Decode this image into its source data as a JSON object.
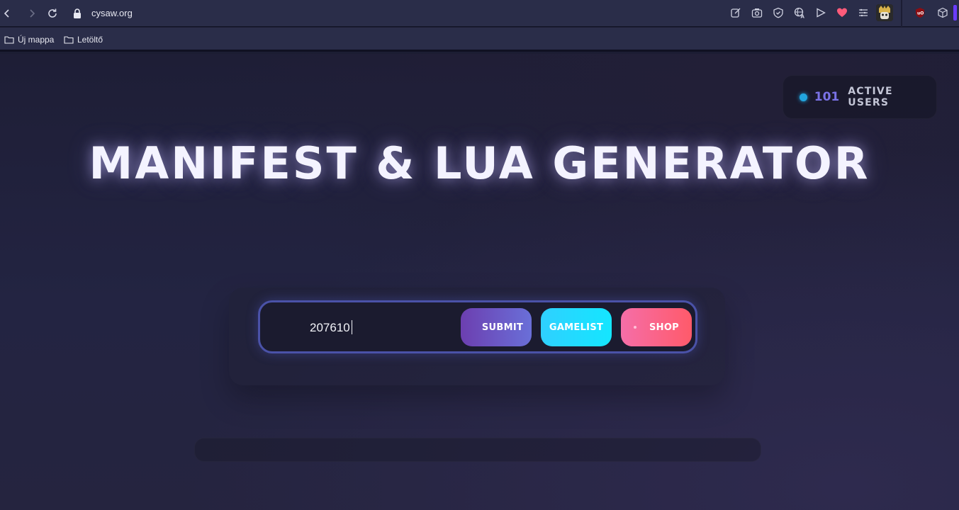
{
  "browser": {
    "url": "cysaw.org",
    "bookmarks": [
      "Új mappa",
      "Letöltő"
    ]
  },
  "header": {
    "active_users_count": "101",
    "active_users_label": "ACTIVE USERS"
  },
  "hero": {
    "title": "MANIFEST & LUA GENERATOR"
  },
  "form": {
    "input_value": "207610",
    "submit_label": "SUBMIT",
    "gamelist_label": "GAMELIST",
    "shop_label": "SHOP"
  },
  "colors": {
    "status_dot": "#22a6e0",
    "count": "#7a72e6",
    "submit_from": "#6c3fb0",
    "submit_to": "#6a6fd8",
    "gamelist": "#14e6ff",
    "shop_from": "#f56ea8",
    "shop_to": "#ff5a6a"
  },
  "icons": [
    "back-icon",
    "forward-icon",
    "reload-icon",
    "lock-icon",
    "edit-icon",
    "camera-icon",
    "shield-icon",
    "translate-icon",
    "play-icon",
    "heart-icon",
    "menu-icon",
    "ublock-icon",
    "cube-icon",
    "folder-icon"
  ]
}
